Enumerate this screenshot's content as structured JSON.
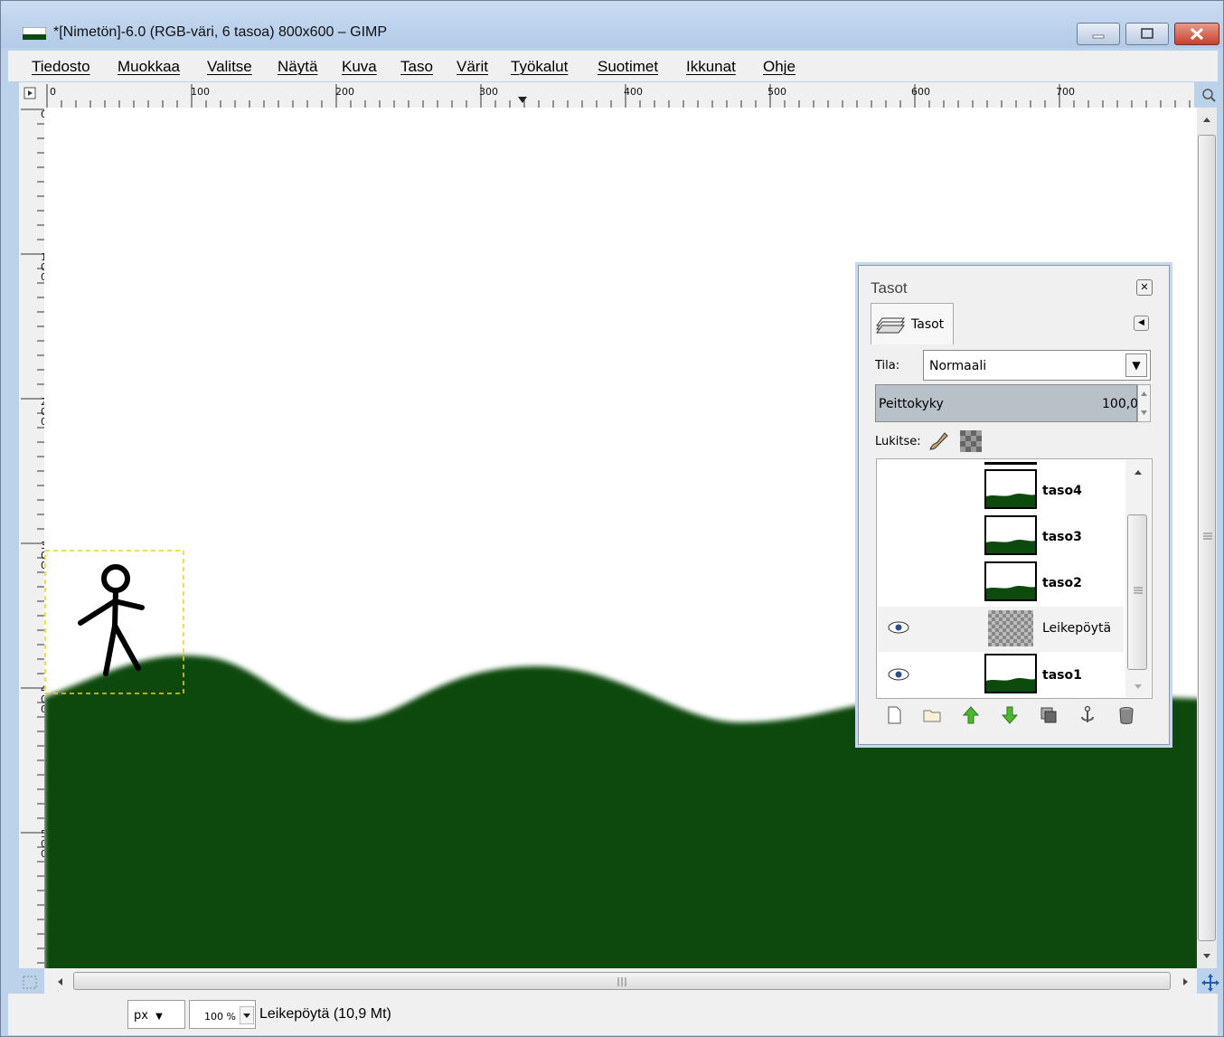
{
  "window": {
    "title": "*[Nimetön]-6.0 (RGB-väri, 6 tasoa) 800x600 – GIMP"
  },
  "menubar": {
    "items": [
      "Tiedosto",
      "Muokkaa",
      "Valitse",
      "Näytä",
      "Kuva",
      "Taso",
      "Värit",
      "Työkalut",
      "Suotimet",
      "Ikkunat",
      "Ohje"
    ]
  },
  "rulers": {
    "top_labels": [
      "0",
      "100",
      "200",
      "300",
      "400",
      "500",
      "600",
      "700"
    ],
    "left_labels": [
      "0",
      "100",
      "200",
      "300",
      "400",
      "500"
    ]
  },
  "statusbar": {
    "unit": "px",
    "zoom": "100 %",
    "message": "Leikepöytä (10,9 Mt)"
  },
  "layers_dock": {
    "title": "Tasot",
    "tab_label": "Tasot",
    "mode_label": "Tila:",
    "mode_value": "Normaali",
    "opacity_label": "Peittokyky",
    "opacity_value": "100,0",
    "lock_label": "Lukitse:",
    "layers": [
      {
        "name": "taso4",
        "visible": false,
        "bold": true
      },
      {
        "name": "taso3",
        "visible": false,
        "bold": true
      },
      {
        "name": "taso2",
        "visible": false,
        "bold": true
      },
      {
        "name": "Leikepöytä",
        "visible": true,
        "bold": false,
        "floating": true
      },
      {
        "name": "taso1",
        "visible": true,
        "bold": true
      }
    ],
    "buttons": [
      "new-layer-icon",
      "new-group-icon",
      "raise-layer-icon",
      "lower-layer-icon",
      "duplicate-layer-icon",
      "anchor-layer-icon",
      "delete-layer-icon"
    ]
  },
  "colors": {
    "ground": "#0d4a0d",
    "selection": "#e8d31a",
    "titlebar": "#bcd1ea"
  }
}
